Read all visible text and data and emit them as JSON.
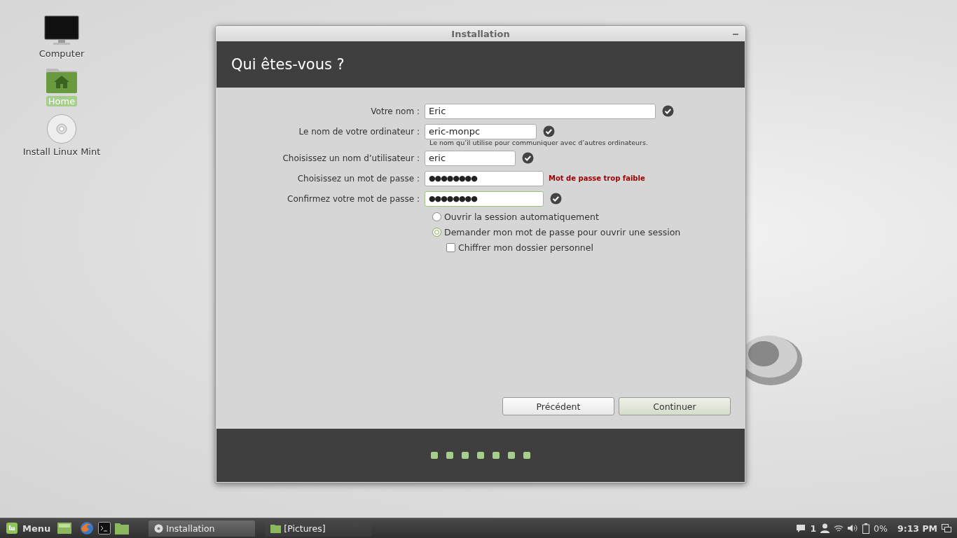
{
  "desktop_icons": [
    {
      "kind": "computer",
      "label": "Computer",
      "selected": false
    },
    {
      "kind": "home",
      "label": "Home",
      "selected": true
    },
    {
      "kind": "disc",
      "label": "Install Linux Mint",
      "selected": false
    }
  ],
  "window": {
    "title": "Installation",
    "heading": "Qui êtes-vous ?"
  },
  "form": {
    "fields": [
      {
        "label": "Votre nom :",
        "value": "Eric",
        "kind": "text",
        "focused": false,
        "valid": true
      },
      {
        "label": "Le nom de votre ordinateur :",
        "value": "eric-monpc",
        "kind": "text",
        "focused": false,
        "valid": true,
        "hint": "Le nom qu’il utilise pour communiquer avec d’autres ordinateurs."
      },
      {
        "label": "Choisissez un nom d’utilisateur :",
        "value": "eric",
        "kind": "text",
        "focused": false,
        "valid": true
      },
      {
        "label": "Choisissez un mot de passe :",
        "value": "●●●●●●●●",
        "kind": "password",
        "focused": false,
        "valid": false,
        "message": "Mot de passe trop faible"
      },
      {
        "label": "Confirmez votre mot de passe :",
        "value": "●●●●●●●●",
        "kind": "password",
        "focused": true,
        "valid": true
      }
    ],
    "login_options": [
      {
        "label": "Ouvrir la session automatiquement",
        "selected": false
      },
      {
        "label": "Demander mon mot de passe pour ouvrir une session",
        "selected": true
      }
    ],
    "encrypt": {
      "label": "Chiffrer mon dossier personnel",
      "checked": false
    }
  },
  "buttons": [
    {
      "label": "Précédent",
      "kind": "secondary"
    },
    {
      "label": "Continuer",
      "kind": "primary"
    }
  ],
  "progress_steps": [
    {
      "done": true
    },
    {
      "done": true
    },
    {
      "done": true
    },
    {
      "done": true
    },
    {
      "done": true
    },
    {
      "done": true
    },
    {
      "done": true
    }
  ],
  "taskbar": {
    "menu_label": "Menu",
    "windows": [
      {
        "label": "Installation",
        "kind": "disc",
        "selected": true
      },
      {
        "label": "[Pictures]",
        "kind": "folder",
        "selected": false
      }
    ],
    "notifications": "1",
    "battery": "0%",
    "clock": "9:13 PM"
  }
}
